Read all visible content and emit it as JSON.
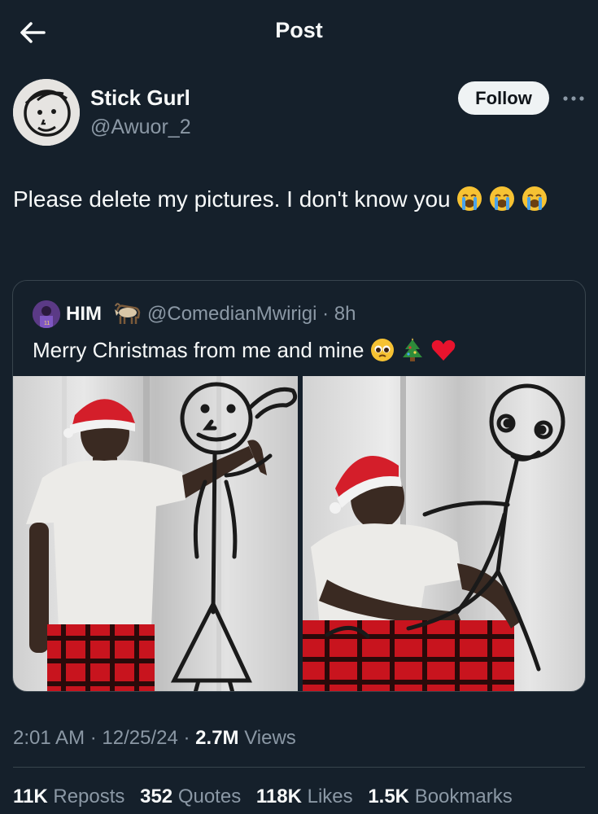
{
  "header": {
    "title": "Post",
    "back_icon": "arrow-left-icon"
  },
  "author": {
    "name": "Stick Gurl",
    "handle": "@Awuor_2",
    "follow_label": "Follow",
    "more_icon": "more-horizontal-icon"
  },
  "tweet": {
    "text": "Please delete my pictures. I don't know you",
    "emojis": [
      "loudly-crying-face",
      "loudly-crying-face",
      "loudly-crying-face"
    ]
  },
  "quote": {
    "name": "HIM",
    "name_emoji": "goat",
    "handle": "@ComedianMwirigi",
    "separator": "·",
    "time": "8h",
    "text": "Merry Christmas from me and mine",
    "text_emojis": [
      "pleading-face",
      "christmas-tree",
      "red-heart"
    ],
    "photos": [
      "man-standing-with-stick-figure",
      "man-sitting-with-stick-figure"
    ]
  },
  "meta": {
    "time": "2:01 AM",
    "date": "12/25/24",
    "separator": "·",
    "views_count": "2.7M",
    "views_label": "Views"
  },
  "stats": [
    {
      "count": "11K",
      "label": "Reposts"
    },
    {
      "count": "352",
      "label": "Quotes"
    },
    {
      "count": "118K",
      "label": "Likes"
    },
    {
      "count": "1.5K",
      "label": "Bookmarks"
    }
  ],
  "colors": {
    "background": "#15202b",
    "text": "#f7f9f9",
    "secondary": "#8b98a5",
    "border": "#38444d",
    "follow_bg": "#eff3f4"
  }
}
